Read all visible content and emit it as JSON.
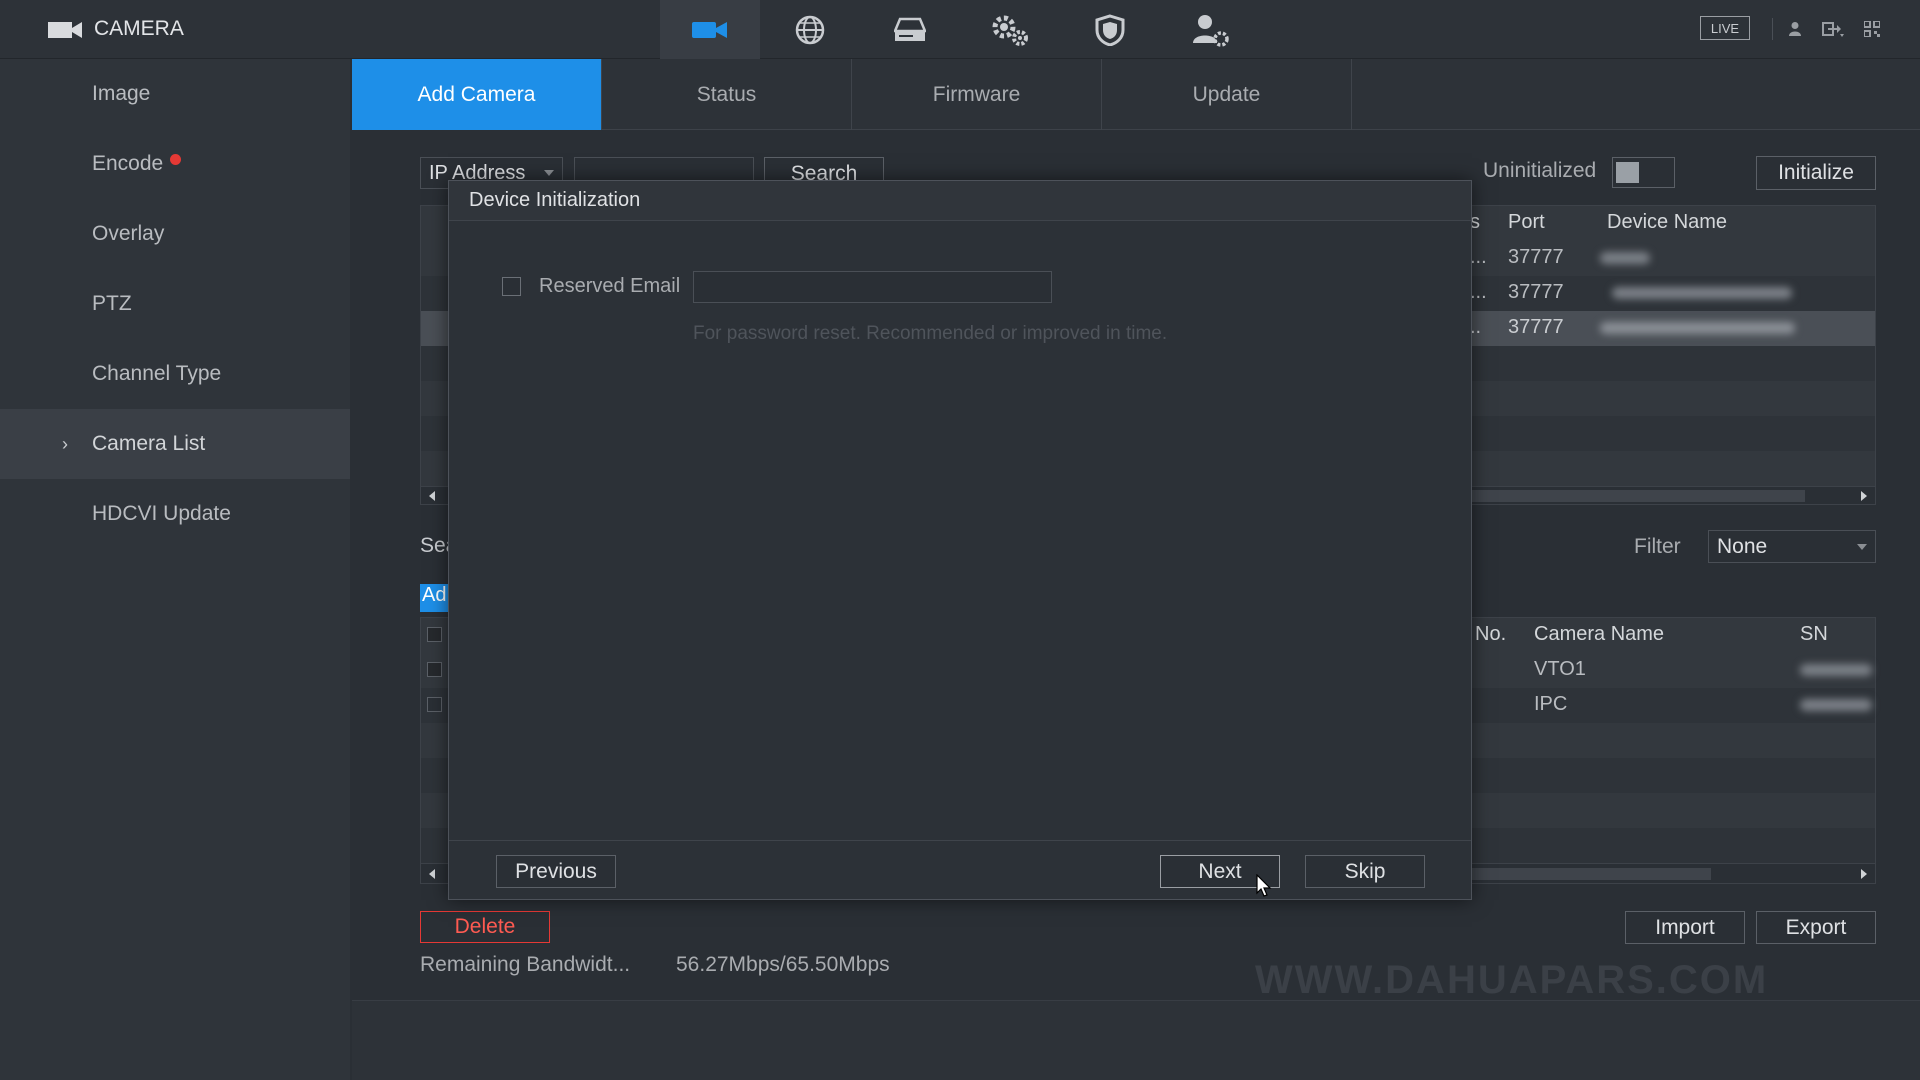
{
  "header": {
    "app_title": "CAMERA",
    "nav_icons": [
      "camera-icon",
      "network-globe-icon",
      "storage-icon",
      "settings-gears-icon",
      "security-shield-icon",
      "account-icon"
    ],
    "live_label": "LIVE"
  },
  "sidebar": {
    "items": [
      {
        "label": "Image"
      },
      {
        "label": "Encode"
      },
      {
        "label": "Overlay"
      },
      {
        "label": "PTZ"
      },
      {
        "label": "Channel Type"
      },
      {
        "label": "Camera List"
      },
      {
        "label": "HDCVI Update"
      }
    ],
    "active_index": 5
  },
  "tabs": [
    {
      "label": "Add Camera",
      "active": true
    },
    {
      "label": "Status"
    },
    {
      "label": "Firmware"
    },
    {
      "label": "Update"
    }
  ],
  "search": {
    "type_selected": "IP Address",
    "search_label": "Search",
    "uninitialized_label": "Uninitialized",
    "initialize_label": "Initialize"
  },
  "device_table": {
    "columns": [
      "s",
      "Port",
      "Device Name"
    ],
    "rows": [
      {
        "status_frag": "...",
        "port": "37777"
      },
      {
        "status_frag": "...",
        "port": "37777"
      },
      {
        "status_frag": "..",
        "port": "37777"
      }
    ]
  },
  "added": {
    "section_frag": "Sea",
    "add_frag": "Ad",
    "filter_label": "Filter",
    "filter_value": "None",
    "columns": [
      "No.",
      "Camera Name",
      "SN"
    ],
    "rows": [
      {
        "camera_name": "VTO1"
      },
      {
        "camera_name": "IPC"
      }
    ]
  },
  "bottom": {
    "delete_label": "Delete",
    "import_label": "Import",
    "export_label": "Export",
    "bandwidth_label": "Remaining Bandwidt...",
    "bandwidth_value": "56.27Mbps/65.50Mbps"
  },
  "modal": {
    "title": "Device Initialization",
    "email_label": "Reserved Email",
    "email_value": "",
    "hint": "For password reset. Recommended or improved in time.",
    "previous_label": "Previous",
    "next_label": "Next",
    "skip_label": "Skip"
  },
  "watermark": "WWW.DAHUAPARS.COM",
  "colors": {
    "accent": "#1e8fe8",
    "danger": "#e53935"
  }
}
